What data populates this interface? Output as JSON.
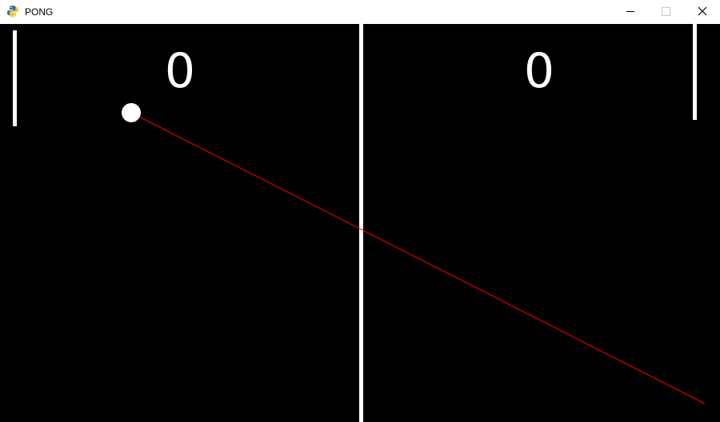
{
  "window": {
    "title": "PONG",
    "icon": "python-icon",
    "controls": [
      "minimize-icon",
      "maximize-icon",
      "close-icon"
    ]
  },
  "game": {
    "score_left": "0",
    "score_right": "0",
    "colors": {
      "background": "#000000",
      "foreground": "#ffffff",
      "trajectory": "#ff0000"
    }
  }
}
